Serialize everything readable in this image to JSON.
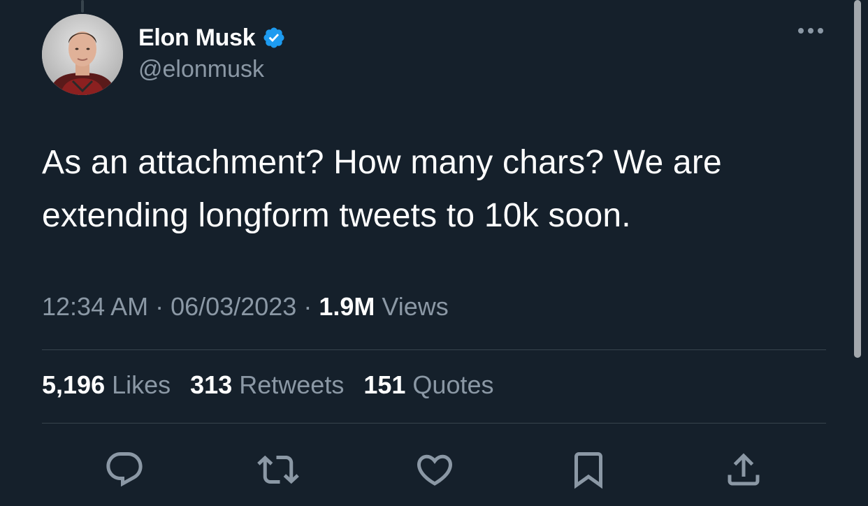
{
  "author": {
    "display_name": "Elon Musk",
    "handle": "@elonmusk",
    "verified": true
  },
  "tweet": {
    "text": "As an attachment? How many chars? We are extending longform tweets to 10k soon.",
    "time": "12:34 AM",
    "date": "06/03/2023",
    "views_count": "1.9M",
    "views_label": "Views",
    "separator": "·"
  },
  "stats": {
    "likes_count": "5,196",
    "likes_label": "Likes",
    "retweets_count": "313",
    "retweets_label": "Retweets",
    "quotes_count": "151",
    "quotes_label": "Quotes"
  },
  "icons": {
    "reply": "reply-icon",
    "retweet": "retweet-icon",
    "like": "heart-icon",
    "bookmark": "bookmark-icon",
    "share": "share-icon",
    "more": "more-icon",
    "verified": "verified-badge-icon"
  },
  "colors": {
    "background": "#15202b",
    "text": "#ffffff",
    "secondary_text": "#8b98a5",
    "verified": "#1d9bf0",
    "divider": "#38444d"
  }
}
